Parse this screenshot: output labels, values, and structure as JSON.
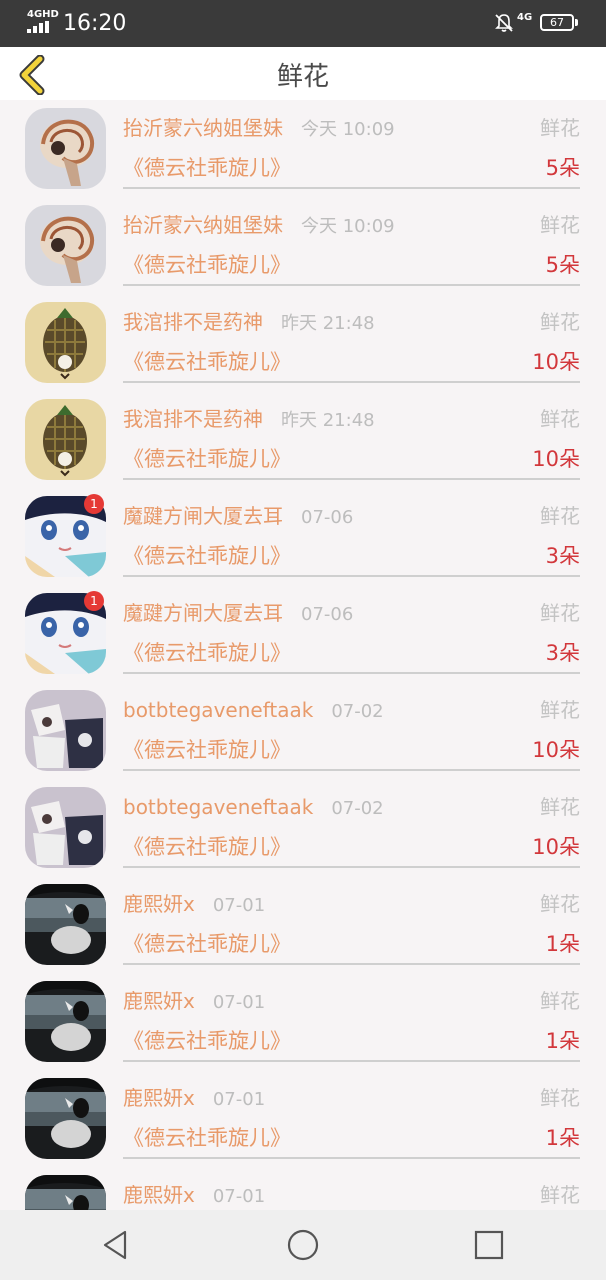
{
  "status_bar": {
    "network_type": "4GHD",
    "time": "16:20",
    "mobile_data": "4G",
    "battery": "67"
  },
  "header": {
    "title": "鲜花"
  },
  "rows": [
    {
      "name": "抬沂蒙六纳姐堡妹",
      "time": "今天 10:09",
      "label": "鲜花",
      "song": "《德云社乖旋儿》",
      "count": "5朵",
      "avatar": "nautilus-shell-avatar"
    },
    {
      "name": "抬沂蒙六纳姐堡妹",
      "time": "今天 10:09",
      "label": "鲜花",
      "song": "《德云社乖旋儿》",
      "count": "5朵",
      "avatar": "nautilus-shell-avatar"
    },
    {
      "name": "我涫排不是药神",
      "time": "昨天 21:48",
      "label": "鲜花",
      "song": "《德云社乖旋儿》",
      "count": "10朵",
      "avatar": "pinecone-avatar"
    },
    {
      "name": "我涫排不是药神",
      "time": "昨天 21:48",
      "label": "鲜花",
      "song": "《德云社乖旋儿》",
      "count": "10朵",
      "avatar": "pinecone-avatar"
    },
    {
      "name": "魔踺方闸大厦去耳",
      "time": "07-06",
      "label": "鲜花",
      "song": "《德云社乖旋儿》",
      "count": "3朵",
      "avatar": "anime-girl-avatar",
      "badge": "1"
    },
    {
      "name": "魔踺方闸大厦去耳",
      "time": "07-06",
      "label": "鲜花",
      "song": "《德云社乖旋儿》",
      "count": "3朵",
      "avatar": "anime-girl-avatar",
      "badge": "1"
    },
    {
      "name": "botbtegaveneftaak",
      "time": "07-02",
      "label": "鲜花",
      "song": "《德云社乖旋儿》",
      "count": "10朵",
      "avatar": "couple-tshirts-avatar"
    },
    {
      "name": "botbtegaveneftaak",
      "time": "07-02",
      "label": "鲜花",
      "song": "《德云社乖旋儿》",
      "count": "10朵",
      "avatar": "couple-tshirts-avatar"
    },
    {
      "name": "鹿熙妍x",
      "time": "07-01",
      "label": "鲜花",
      "song": "《德云社乖旋儿》",
      "count": "1朵",
      "avatar": "car-window-avatar"
    },
    {
      "name": "鹿熙妍x",
      "time": "07-01",
      "label": "鲜花",
      "song": "《德云社乖旋儿》",
      "count": "1朵",
      "avatar": "car-window-avatar"
    },
    {
      "name": "鹿熙妍x",
      "time": "07-01",
      "label": "鲜花",
      "song": "《德云社乖旋儿》",
      "count": "1朵",
      "avatar": "car-window-avatar"
    },
    {
      "name": "鹿熙妍x",
      "time": "07-01",
      "label": "鲜花",
      "song": "",
      "count": "",
      "avatar": "car-window-avatar"
    }
  ],
  "bottom_nav": {
    "icons": [
      "back-triangle-icon",
      "home-circle-icon",
      "recents-square-icon"
    ]
  },
  "colors": {
    "name": "#e89a6a",
    "count": "#d2373b",
    "muted": "#bdbdbd",
    "back_arrow": "#f2d33b"
  }
}
